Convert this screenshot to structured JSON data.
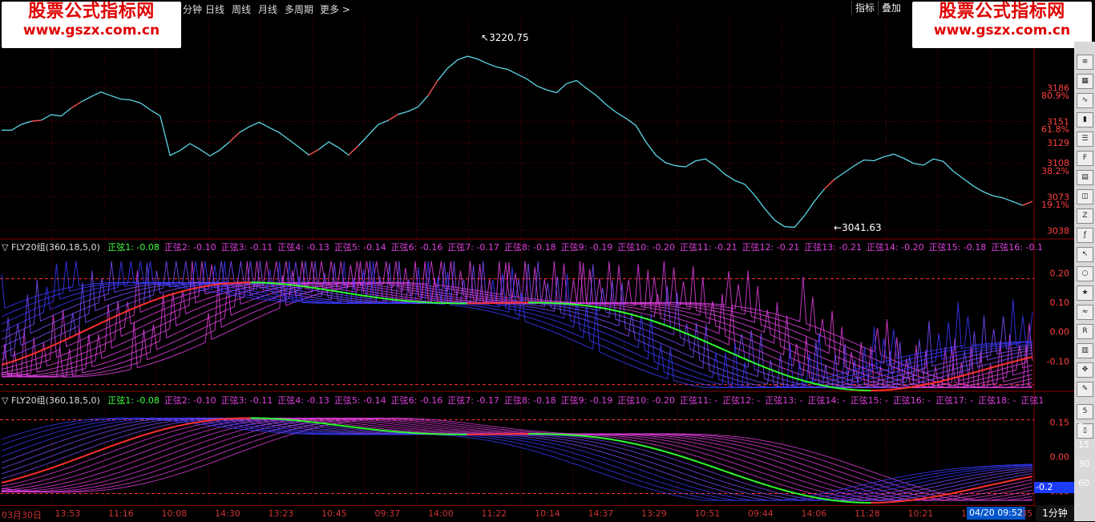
{
  "toolbar": {
    "periods": [
      "分钟",
      "日线",
      "周线",
      "月线",
      "多周期",
      "更多 >"
    ],
    "right_buttons": [
      "指标",
      "叠加"
    ]
  },
  "watermark": {
    "line1": "股票公式指标网",
    "line2": "www.gszx.com.cn"
  },
  "price_panel": {
    "high_label": "3220.75",
    "low_label": "3041.63",
    "axis_labels": [
      "3186",
      "80.9%",
      "3151",
      "61.8%",
      "3129",
      "3108",
      "38.2%",
      "3073",
      "19.1%",
      "3038"
    ],
    "axis_values": [
      3186,
      3151,
      3129,
      3108,
      3073,
      3038
    ],
    "pct_values": [
      3186,
      3151,
      3108,
      3073
    ],
    "ylim": [
      3030,
      3232
    ]
  },
  "indicator1": {
    "name": "▽ FLY20组(360,18,5,0)",
    "items": [
      "正弦1: -0.08",
      "正弦2: -0.10",
      "正弦3: -0.11",
      "正弦4: -0.13",
      "正弦5: -0.14",
      "正弦6: -0.16",
      "正弦7: -0.17",
      "正弦8: -0.18",
      "正弦9: -0.19",
      "正弦10: -0.20",
      "正弦11: -0.21",
      "正弦12: -0.21",
      "正弦13: -0.21",
      "正弦14: -0.20",
      "正弦15: -0.18",
      "正弦16: -0.1"
    ],
    "axis_labels": [
      "0.20",
      "0.10",
      "0.00",
      "-0.10"
    ],
    "axis_values": [
      0.2,
      0.1,
      0.0,
      -0.1
    ],
    "ylim": [
      -0.2,
      0.25
    ]
  },
  "indicator2": {
    "name": "▽ FLY20组(360,18,5,0)",
    "items": [
      "正弦1: -0.08",
      "正弦2: -0.10",
      "正弦3: -0.11",
      "正弦4: -0.13",
      "正弦5: -0.14",
      "正弦6: -0.16",
      "正弦7: -0.17",
      "正弦8: -0.18",
      "正弦9: -0.19",
      "正弦10: -0.20",
      "正弦11: -",
      "正弦12: -",
      "正弦13: -",
      "正弦14: -",
      "正弦15: -",
      "正弦16: -",
      "正弦17: -",
      "正弦18: -",
      "正弦1"
    ],
    "axis_labels": [
      "0.15",
      "0.00",
      "-0.15"
    ],
    "axis_values": [
      0.15,
      0.0,
      -0.15
    ],
    "current_badge": "-0.2",
    "ylim": [
      -0.2,
      0.2
    ]
  },
  "time_axis": {
    "labels": [
      "03月30日",
      "13:53",
      "11:16",
      "10:08",
      "14:30",
      "13:23",
      "10:45",
      "09:37",
      "14:00",
      "11:22",
      "10:14",
      "14:37",
      "13:29",
      "10:51",
      "09:44",
      "14:06",
      "11:28",
      "10:21",
      "14"
    ],
    "cursor_datetime": "04/20 09:52",
    "cursor_suffix": "35",
    "timeframe": "1分钟"
  },
  "right_side_numbers": [
    "1",
    "5",
    "15",
    "30",
    "60"
  ],
  "chart_data": {
    "type": "line",
    "series": [
      {
        "values": [
          3142,
          3140,
          3146,
          3151,
          3154,
          3160,
          3157,
          3163,
          3169,
          3176,
          3183,
          3180,
          3175,
          3172,
          3168,
          3162,
          3158,
          3118,
          3122,
          3127,
          3120,
          3114,
          3122,
          3132,
          3141,
          3145,
          3148,
          3143,
          3140,
          3134,
          3126,
          3116,
          3120,
          3128,
          3124,
          3118,
          3128,
          3137,
          3146,
          3150,
          3158,
          3163,
          3168,
          3178,
          3192,
          3204,
          3214,
          3220,
          3218,
          3212,
          3206,
          3203,
          3199,
          3196,
          3190,
          3185,
          3180,
          3188,
          3192,
          3186,
          3180,
          3170,
          3160,
          3152,
          3145,
          3130,
          3118,
          3110,
          3105,
          3102,
          3108,
          3112,
          3107,
          3098,
          3090,
          3084,
          3072,
          3060,
          3050,
          3044,
          3042,
          3052,
          3066,
          3080,
          3092,
          3100,
          3106,
          3110,
          3108,
          3113,
          3118,
          3115,
          3109,
          3105,
          3110,
          3108,
          3100,
          3094,
          3086,
          3078,
          3072,
          3070,
          3068,
          3066,
          3070
        ]
      }
    ]
  }
}
